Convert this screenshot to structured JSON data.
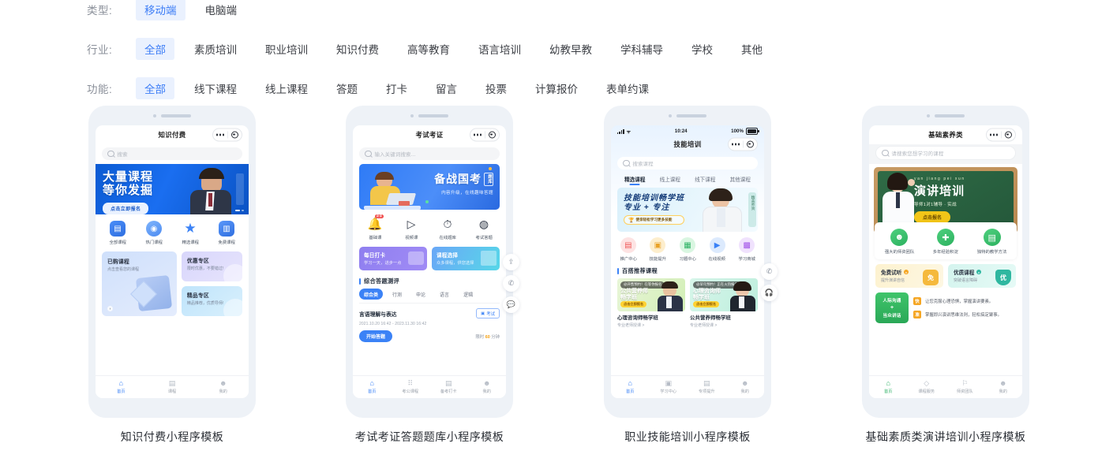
{
  "filters": [
    {
      "label": "类型:",
      "name": "type",
      "options": [
        {
          "text": "移动端",
          "active": true
        },
        {
          "text": "电脑端",
          "active": false
        }
      ]
    },
    {
      "label": "行业:",
      "name": "industry",
      "options": [
        {
          "text": "全部",
          "active": true
        },
        {
          "text": "素质培训",
          "active": false
        },
        {
          "text": "职业培训",
          "active": false
        },
        {
          "text": "知识付费",
          "active": false
        },
        {
          "text": "高等教育",
          "active": false
        },
        {
          "text": "语言培训",
          "active": false
        },
        {
          "text": "幼教早教",
          "active": false
        },
        {
          "text": "学科辅导",
          "active": false
        },
        {
          "text": "学校",
          "active": false
        },
        {
          "text": "其他",
          "active": false
        }
      ]
    },
    {
      "label": "功能:",
      "name": "feature",
      "options": [
        {
          "text": "全部",
          "active": true
        },
        {
          "text": "线下课程",
          "active": false
        },
        {
          "text": "线上课程",
          "active": false
        },
        {
          "text": "答题",
          "active": false
        },
        {
          "text": "打卡",
          "active": false
        },
        {
          "text": "留言",
          "active": false
        },
        {
          "text": "投票",
          "active": false
        },
        {
          "text": "计算报价",
          "active": false
        },
        {
          "text": "表单约课",
          "active": false
        }
      ]
    }
  ],
  "colors": {
    "accent_blue": "#3b7cf6",
    "chip_bg": "#eaf1fe",
    "accent_green": "#34b36a",
    "accent_orange": "#f5a623",
    "phone_frame": "#eef2f7"
  },
  "cards": [
    {
      "caption": "知识付费小程序模板",
      "phone": {
        "nav_title": "知识付费",
        "search_placeholder": "搜索",
        "banner": {
          "title_line1": "大量课程",
          "title_line2": "等你发掘",
          "button": "点击立即报名"
        },
        "grid": [
          {
            "label": "全部课程",
            "icon": "book-icon"
          },
          {
            "label": "热门课程",
            "icon": "flame-icon"
          },
          {
            "label": "精选课程",
            "icon": "star-icon"
          },
          {
            "label": "免费课程",
            "icon": "bookmark-icon"
          }
        ],
        "promo": {
          "main": {
            "title": "已购课程",
            "sub": "点击查看您的课程"
          },
          "a": {
            "title": "优惠专区",
            "sub": "限时优惠，不要错过!"
          },
          "b": {
            "title": "精品专区",
            "sub": "精品推荐，优质导师!"
          }
        },
        "tabbar": [
          {
            "label": "首页",
            "icon": "home-icon",
            "active": true
          },
          {
            "label": "课程",
            "icon": "list-icon",
            "active": false
          },
          {
            "label": "我的",
            "icon": "user-icon",
            "active": false
          }
        ]
      }
    },
    {
      "caption": "考试考证答题题库小程序模板",
      "phone": {
        "nav_title": "考试考证",
        "search_placeholder": "输入关键词搜索...",
        "banner": {
          "title": "备战国考",
          "badge": "题库",
          "subtitle": "内容升级，在线趣味答题"
        },
        "grid": [
          {
            "label": "基础课",
            "icon": "bell-icon"
          },
          {
            "label": "视频课",
            "icon": "video-icon"
          },
          {
            "label": "在线题库",
            "icon": "timer-icon"
          },
          {
            "label": "考试答题",
            "icon": "quiz-icon"
          }
        ],
        "duo": [
          {
            "title": "每日打卡",
            "sub": "学习一天，进步一点"
          },
          {
            "title": "课程选择",
            "sub": "众多课程，供您选择"
          }
        ],
        "section_title": "综合答题测评",
        "pills": [
          {
            "text": "综合类",
            "active": true
          },
          {
            "text": "行测",
            "active": false
          },
          {
            "text": "申论",
            "active": false
          },
          {
            "text": "语言",
            "active": false
          },
          {
            "text": "逻辑",
            "active": false
          }
        ],
        "quiz": {
          "title": "言语理解与表达",
          "tag": "考试",
          "date": "2021.10.20 16:42 - 2023.11.30 16:42",
          "button": "开始答题",
          "limit_prefix": "限时",
          "limit_value": "60",
          "limit_suffix": "分钟"
        },
        "floaters": [
          {
            "icon": "share-icon"
          },
          {
            "icon": "phone-icon"
          },
          {
            "icon": "chat-icon"
          }
        ],
        "tabbar": [
          {
            "label": "首页",
            "icon": "home-icon",
            "active": true
          },
          {
            "label": "考公课程",
            "icon": "grid-icon",
            "active": false
          },
          {
            "label": "备考打卡",
            "icon": "calendar-icon",
            "active": false
          },
          {
            "label": "我的",
            "icon": "user-icon",
            "active": false
          }
        ]
      }
    },
    {
      "caption": "职业技能培训小程序模板",
      "phone": {
        "statusbar": {
          "time": "10:24",
          "battery": "100%",
          "signal": "signal-icon",
          "wifi": "wifi-icon"
        },
        "nav_title": "技能培训",
        "search_placeholder": "搜索课程",
        "tabs": [
          {
            "text": "精选课程",
            "active": true
          },
          {
            "text": "线上课程",
            "active": false
          },
          {
            "text": "线下课程",
            "active": false
          },
          {
            "text": "其他课程",
            "active": false
          }
        ],
        "banner": {
          "title_line1": "技能培训畅学班",
          "title_line2": "专业 + 专注",
          "badge": "使亲轻松学习更多技能",
          "side": "精英师资"
        },
        "grid": [
          {
            "label": "推广中心",
            "icon": "gift-icon"
          },
          {
            "label": "技能提升",
            "icon": "clipboard-icon"
          },
          {
            "label": "习题中心",
            "icon": "note-icon"
          },
          {
            "label": "在线视频",
            "icon": "camera-icon"
          },
          {
            "label": "学习商城",
            "icon": "bag-icon"
          }
        ],
        "section_title": "百搭推荐课程",
        "courses": [
          {
            "tag": "@开售预约！在等你报名",
            "thumb_title": "公共营养师\n畅学班",
            "badge": "点击立即报名",
            "title": "心理咨询师畅学班",
            "sub": "专业老师授课 >"
          },
          {
            "tag": "@早鸟预约！正在火热报名",
            "thumb_title": "心理咨询师\n畅学班",
            "badge": "点击立即报名",
            "title": "公共营养师畅学班",
            "sub": "专业老师授课 >"
          }
        ],
        "floaters": [
          {
            "icon": "phone-icon"
          },
          {
            "icon": "headset-icon"
          }
        ],
        "tabbar": [
          {
            "label": "首页",
            "icon": "home-icon",
            "active": true
          },
          {
            "label": "学习中心",
            "icon": "play-box-icon",
            "active": false
          },
          {
            "label": "专项提升",
            "icon": "note-icon",
            "active": false
          },
          {
            "label": "我的",
            "icon": "user-icon",
            "active": false
          }
        ]
      }
    },
    {
      "caption": "基础素质类演讲培训小程序模板",
      "phone": {
        "nav_title": "基础素养类",
        "search_placeholder": "请搜索您想学习的课程",
        "banner": {
          "pinyin": "yan jiang pei xun",
          "title": "演讲培训",
          "subtitle": "导师1对1辅导 · 实战",
          "button": "点击报名"
        },
        "features": [
          {
            "label": "强大的师资团队",
            "icon": "people-icon"
          },
          {
            "label": "多年经验积淀",
            "icon": "shield-icon"
          },
          {
            "label": "独特的教学方法",
            "icon": "book-icon"
          }
        ],
        "duo": [
          {
            "title": "免费试听",
            "sub": "提升演讲自信",
            "badge": "免"
          },
          {
            "title": "优质课程",
            "sub": "突破语言障碍",
            "badge": "优"
          }
        ],
        "greenblock": {
          "left_top": "人际沟通",
          "left_plus": "+",
          "left_bottom": "当众讲话",
          "items": [
            {
              "bx": "快",
              "text": "让您克服心理恐惧，掌握演讲要素。"
            },
            {
              "bx": "准",
              "text": "掌握即兴演讲思维法则，轻松搞定聚事。"
            }
          ]
        },
        "tabbar": [
          {
            "label": "首页",
            "icon": "home-icon",
            "active": true
          },
          {
            "label": "课程服务",
            "icon": "box-icon",
            "active": false
          },
          {
            "label": "师资团队",
            "icon": "teacher-icon",
            "active": false
          },
          {
            "label": "我的",
            "icon": "user-icon",
            "active": false
          }
        ]
      }
    }
  ]
}
